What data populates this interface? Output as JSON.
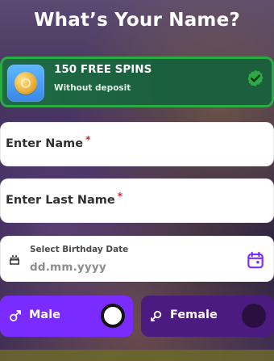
{
  "header": {
    "title": "What’s Your Name?"
  },
  "bonus": {
    "title": "150 FREE SPINS",
    "subtitle": "Without deposit",
    "icon": "coin-icon",
    "status_icon": "check-circle-icon",
    "accent_color": "#2cab44"
  },
  "form": {
    "first_name": {
      "label": "Enter Name",
      "required_mark": "*"
    },
    "last_name": {
      "label": "Enter Last Name",
      "required_mark": "*"
    },
    "birthday": {
      "label": "Select Birthday Date",
      "placeholder": "dd.mm.yyyy",
      "left_icon": "cake-icon",
      "right_icon": "calendar-icon"
    },
    "gender": {
      "male": {
        "label": "Male",
        "icon": "male-icon",
        "selected": true,
        "color": "#7a2cff"
      },
      "female": {
        "label": "Female",
        "icon": "female-icon",
        "selected": false,
        "color": "#4b1b7f"
      }
    }
  }
}
